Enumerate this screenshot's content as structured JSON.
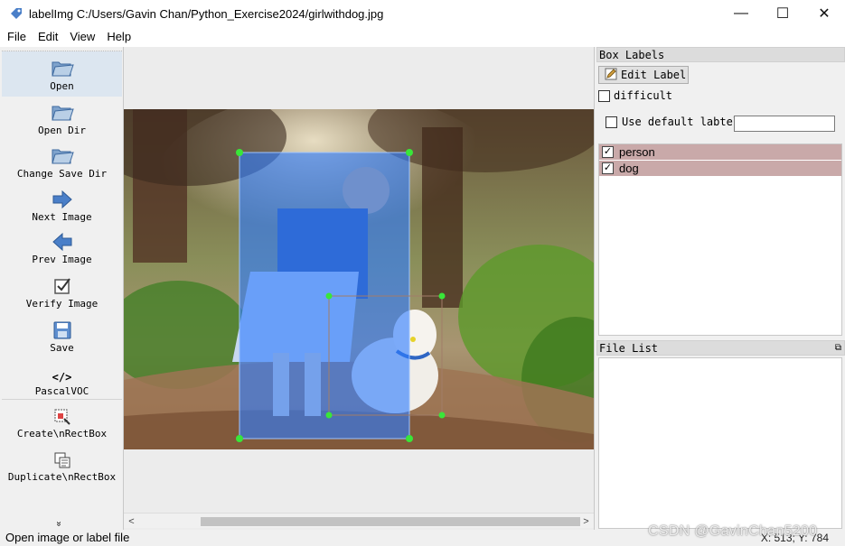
{
  "window": {
    "title": "labelImg C:/Users/Gavin Chan/Python_Exercise2024/girlwithdog.jpg",
    "minimize_glyph": "—",
    "maximize_glyph": "☐",
    "close_glyph": "✕"
  },
  "menu": [
    "File",
    "Edit",
    "View",
    "Help"
  ],
  "toolbar": {
    "open": "Open",
    "open_dir": "Open Dir",
    "change_save_dir": "Change Save Dir",
    "next_image": "Next Image",
    "prev_image": "Prev Image",
    "verify_image": "Verify Image",
    "save": "Save",
    "format_glyph": "</>",
    "format": "PascalVOC",
    "create_rectbox": "Create\\nRectBox",
    "duplicate_rectbox": "Duplicate\\nRectBox",
    "expand_glyph": "»"
  },
  "box_labels": {
    "title": "Box Labels",
    "edit_label": "Edit Label",
    "difficult": "difficult",
    "use_default_label": "Use default labtel",
    "default_label_value": "",
    "labels": [
      {
        "name": "person",
        "checked": true
      },
      {
        "name": "dog",
        "checked": true
      }
    ]
  },
  "file_list": {
    "title": "File List",
    "items": []
  },
  "status": {
    "message": "Open image or label file",
    "coords": "X: 513; Y: 784"
  },
  "watermark": "CSDN @GavinChan5200",
  "scroll": {
    "left_glyph": "<",
    "right_glyph": ">"
  },
  "colors": {
    "box_fill": "#2f7cff",
    "handle": "#39e639",
    "label_row": "#c9a9a9",
    "icon_blue": "#4a7fc8"
  }
}
